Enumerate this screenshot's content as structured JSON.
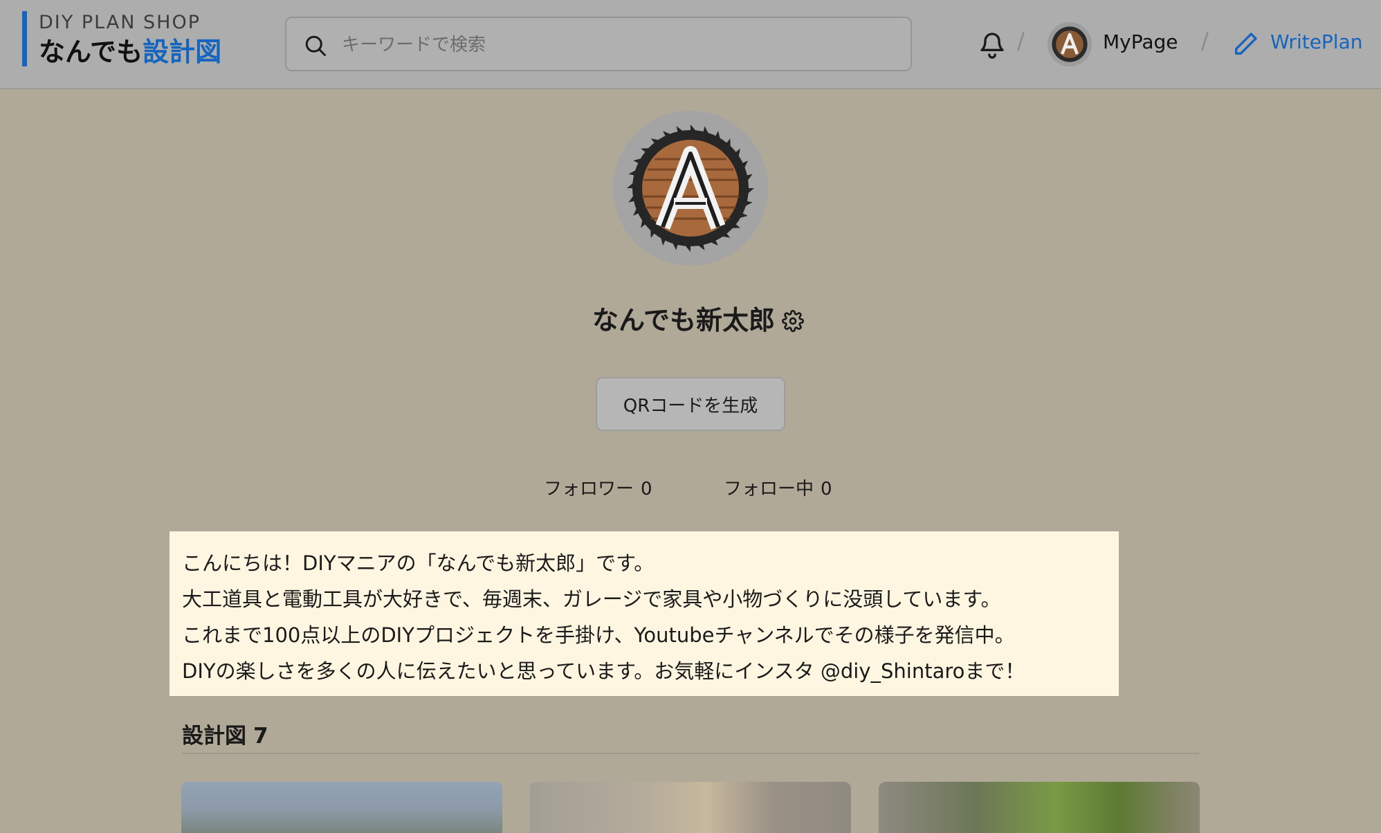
{
  "header": {
    "brand_top": "DIY PLAN SHOP",
    "brand_main_part1": "なんでも",
    "brand_main_part2": "設計図",
    "search_placeholder": "キーワードで検索",
    "separator": "/",
    "mypage_label": "MyPage",
    "writeplan_label": "WritePlan"
  },
  "profile": {
    "username": "なんでも新太郎",
    "qr_button_label": "QRコードを生成",
    "followers_label": "フォロワー",
    "followers_count": "0",
    "following_label": "フォロー中",
    "following_count": "0",
    "bio_lines": [
      "こんにちは！DIYマニアの「なんでも新太郎」です。",
      "大工道具と電動工具が大好きで、毎週末、ガレージで家具や小物づくりに没頭しています。",
      "これまで100点以上のDIYプロジェクトを手掛け、Youtubeチャンネルでその様子を発信中。",
      "DIYの楽しさを多くの人に伝えたいと思っています。お気軽にインスタ @diy_Shintaroまで！"
    ]
  },
  "plans": {
    "heading": "設計図",
    "count": "7"
  },
  "colors": {
    "accent": "#1565c0",
    "bio_background": "#fff6e1",
    "page_overlay": "#b0a998"
  },
  "icons": {
    "search": "search-icon",
    "bell": "bell-icon",
    "pencil": "pencil-icon",
    "gear": "gear-icon",
    "avatar": "saw-blade-letter-a-logo"
  }
}
